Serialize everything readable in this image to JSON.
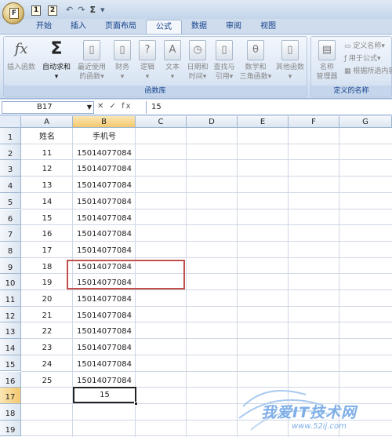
{
  "qat": {
    "key_1": "1",
    "key_2": "2",
    "office_key": "F"
  },
  "tabs": [
    {
      "label": "开始",
      "active": false
    },
    {
      "label": "插入",
      "active": false
    },
    {
      "label": "页面布局",
      "active": false
    },
    {
      "label": "公式",
      "active": true
    },
    {
      "label": "数据",
      "active": false
    },
    {
      "label": "审阅",
      "active": false
    },
    {
      "label": "视图",
      "active": false
    }
  ],
  "ribbon": {
    "insert_function": "插入函数",
    "autosum_line1": "自动求和",
    "autosum_line2": "▾",
    "recent_line1": "最近使用",
    "recent_line2": "的函数▾",
    "finance_line1": "财务",
    "finance_line2": "▾",
    "logic_line1": "逻辑",
    "logic_line2": "▾",
    "text_line1": "文本",
    "text_line2": "▾",
    "datetime_line1": "日期和",
    "datetime_line2": "时间▾",
    "lookup_line1": "查找与",
    "lookup_line2": "引用▾",
    "math_line1": "数学和",
    "math_line2": "三角函数▾",
    "other_line1": "其他函数",
    "other_line2": "▾",
    "function_library": "函数库",
    "name_manager_line1": "名称",
    "name_manager_line2": "管理器",
    "define_name": "定义名称▾",
    "use_in_formula": "用于公式▾",
    "create_from_selection": "根据所选内容",
    "defined_names": "定义的名称"
  },
  "formula_bar": {
    "name_box": "B17",
    "buttons": "✕ ✓ fx",
    "value": "15"
  },
  "columns": [
    "A",
    "B",
    "C",
    "D",
    "E",
    "F",
    "G"
  ],
  "rows": [
    "1",
    "2",
    "3",
    "4",
    "5",
    "6",
    "7",
    "8",
    "9",
    "10",
    "11",
    "12",
    "13",
    "14",
    "15",
    "16",
    "17",
    "18",
    "19"
  ],
  "table": {
    "header": [
      "姓名",
      "手机号"
    ],
    "data": [
      [
        "11",
        "15014077084"
      ],
      [
        "12",
        "15014077084"
      ],
      [
        "13",
        "15014077084"
      ],
      [
        "14",
        "15014077084"
      ],
      [
        "15",
        "15014077084"
      ],
      [
        "16",
        "15014077084"
      ],
      [
        "17",
        "15014077084"
      ],
      [
        "18",
        "15014077084"
      ],
      [
        "19",
        "15014077084"
      ],
      [
        "20",
        "15014077084"
      ],
      [
        "21",
        "15014077084"
      ],
      [
        "22",
        "15014077084"
      ],
      [
        "23",
        "15014077084"
      ],
      [
        "24",
        "15014077084"
      ],
      [
        "25",
        "15014077084"
      ]
    ]
  },
  "active_cell": {
    "value": "15"
  },
  "watermark": {
    "text": "我爱IT技术网",
    "url": "www.52ij.com"
  }
}
